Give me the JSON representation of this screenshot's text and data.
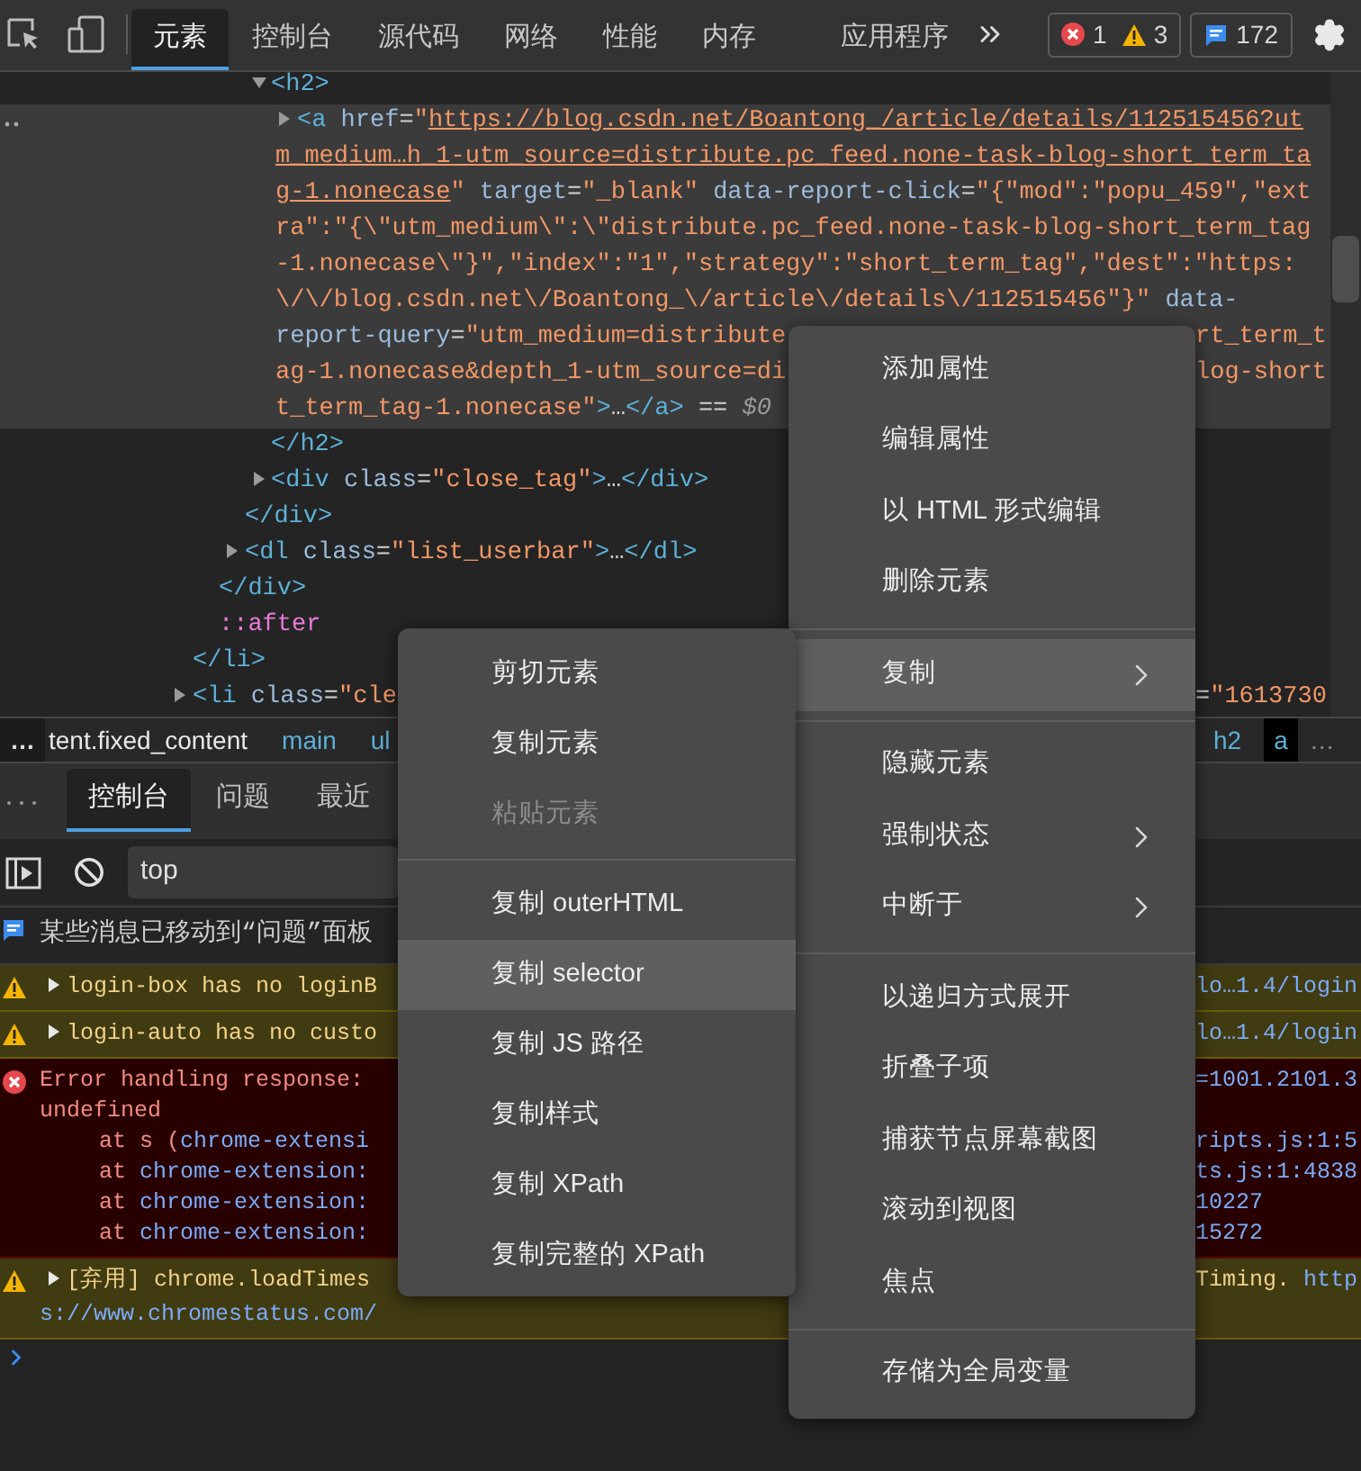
{
  "toolbar": {
    "tabs": [
      {
        "label": "元素",
        "selected": true
      },
      {
        "label": "控制台",
        "selected": false
      },
      {
        "label": "源代码",
        "selected": false
      },
      {
        "label": "网络",
        "selected": false
      },
      {
        "label": "性能",
        "selected": false
      },
      {
        "label": "内存",
        "selected": false
      },
      {
        "label": "应用程序",
        "selected": false
      }
    ],
    "errors": "1",
    "warnings": "3",
    "messages": "172"
  },
  "elements": {
    "tree": [
      {
        "children": [
          {
            "children": [
              {
                "children": [
                  {
                    "expanded": true,
                    "selected": false,
                    "lines": [
                      {
                        "segments": [
                          {
                            "kind": "tag",
                            "text": "<h2>"
                          }
                        ]
                      }
                    ],
                    "children": [
                      {
                        "expanded": false,
                        "selected": true,
                        "lines": [
                          {
                            "segments": [
                              {
                                "kind": "tag",
                                "text": "<a"
                              },
                              {
                                "kind": "attr",
                                "text": " href"
                              },
                              {
                                "kind": "text",
                                "text": "="
                              },
                              {
                                "kind": "value",
                                "text": "\""
                              },
                              {
                                "kind": "link",
                                "text": "https://blog.csdn.net/Boantong_/article/details/112515456?ut"
                              }
                            ]
                          },
                          {
                            "segments": [
                              {
                                "kind": "link",
                                "text": "m_medium…h_1-utm_source=distribute.pc_feed.none-task-blog-short_term_ta"
                              }
                            ]
                          },
                          {
                            "segments": [
                              {
                                "kind": "link",
                                "text": "g-1.nonecase"
                              },
                              {
                                "kind": "value",
                                "text": "\""
                              },
                              {
                                "kind": "attr",
                                "text": " target"
                              },
                              {
                                "kind": "text",
                                "text": "="
                              },
                              {
                                "kind": "value",
                                "text": "\"_blank\""
                              },
                              {
                                "kind": "attr",
                                "text": " data-report-click"
                              },
                              {
                                "kind": "text",
                                "text": "="
                              },
                              {
                                "kind": "value",
                                "text": "\"{\"mod\":\"popu_459\",\"ext"
                              }
                            ]
                          },
                          {
                            "segments": [
                              {
                                "kind": "value",
                                "text": "ra\":\"{\\\"utm_medium\\\":\\\"distribute.pc_feed.none-task-blog-short_term_tag"
                              }
                            ]
                          },
                          {
                            "segments": [
                              {
                                "kind": "value",
                                "text": "-1.nonecase\\\"}\",\"index\":\"1\",\"strategy\":\"short_term_tag\",\"dest\":\"https:"
                              }
                            ]
                          },
                          {
                            "segments": [
                              {
                                "kind": "value",
                                "text": "\\/\\/blog.csdn.net\\/Boantong_\\/article\\/details\\/112515456\"}\""
                              },
                              {
                                "kind": "attr",
                                "text": " data-"
                              }
                            ]
                          },
                          {
                            "segments": [
                              {
                                "kind": "attr",
                                "text": "report-query"
                              },
                              {
                                "kind": "text",
                                "text": "="
                              },
                              {
                                "kind": "value",
                                "text": "\"utm_medium=distribute"
                              }
                            ],
                            "right_segments": [
                              {
                                "kind": "value",
                                "text": "rt_term_t"
                              }
                            ]
                          },
                          {
                            "segments": [
                              {
                                "kind": "value",
                                "text": "ag-1.nonecase&depth_1-utm_source=di"
                              }
                            ],
                            "right_segments": [
                              {
                                "kind": "value",
                                "text": "log-short"
                              }
                            ]
                          },
                          {
                            "segments": [
                              {
                                "kind": "value",
                                "text": "t_term_tag-1.nonecase\""
                              },
                              {
                                "kind": "tag",
                                "text": ">"
                              },
                              {
                                "kind": "text",
                                "text": "…"
                              },
                              {
                                "kind": "tag",
                                "text": "</a>"
                              },
                              {
                                "kind": "text",
                                "text": " == "
                              },
                              {
                                "kind": "comment",
                                "text": "$0"
                              }
                            ]
                          }
                        ]
                      }
                    ]
                  },
                  {
                    "selected": false,
                    "lines": [
                      {
                        "segments": [
                          {
                            "kind": "tag",
                            "text": "</h2>"
                          }
                        ]
                      }
                    ]
                  },
                  {
                    "expanded": false,
                    "selected": false,
                    "lines": [
                      {
                        "segments": [
                          {
                            "kind": "tag",
                            "text": "<div"
                          },
                          {
                            "kind": "attr",
                            "text": " class"
                          },
                          {
                            "kind": "text",
                            "text": "="
                          },
                          {
                            "kind": "value",
                            "text": "\"close_tag\""
                          },
                          {
                            "kind": "tag",
                            "text": ">"
                          },
                          {
                            "kind": "text",
                            "text": "…"
                          },
                          {
                            "kind": "tag",
                            "text": "</div>"
                          }
                        ]
                      }
                    ]
                  }
                ]
              },
              {
                "selected": false,
                "lines": [
                  {
                    "segments": [
                      {
                        "kind": "tag",
                        "text": "</div>"
                      }
                    ]
                  }
                ]
              },
              {
                "expanded": false,
                "selected": false,
                "lines": [
                  {
                    "segments": [
                      {
                        "kind": "tag",
                        "text": "<dl"
                      },
                      {
                        "kind": "attr",
                        "text": " class"
                      },
                      {
                        "kind": "text",
                        "text": "="
                      },
                      {
                        "kind": "value",
                        "text": "\"list_userbar\""
                      },
                      {
                        "kind": "tag",
                        "text": ">"
                      },
                      {
                        "kind": "text",
                        "text": "…"
                      },
                      {
                        "kind": "tag",
                        "text": "</dl>"
                      }
                    ]
                  }
                ]
              }
            ]
          },
          {
            "selected": false,
            "lines": [
              {
                "segments": [
                  {
                    "kind": "tag",
                    "text": "</div>"
                  }
                ]
              }
            ]
          },
          {
            "selected": false,
            "lines": [
              {
                "segments": [
                  {
                    "kind": "pseudo",
                    "text": "::after"
                  }
                ]
              }
            ]
          }
        ]
      },
      {
        "selected": false,
        "lines": [
          {
            "segments": [
              {
                "kind": "tag",
                "text": "</li>"
              }
            ]
          }
        ]
      },
      {
        "expanded": false,
        "selected": false,
        "lines": [
          {
            "segments": [
              {
                "kind": "tag",
                "text": "<li"
              },
              {
                "kind": "attr",
                "text": " class"
              },
              {
                "kind": "text",
                "text": "="
              },
              {
                "kind": "value",
                "text": "\"cle"
              }
            ],
            "right_segments": [
              {
                "kind": "text",
                "text": "="
              },
              {
                "kind": "value",
                "text": "\"1613730"
              }
            ]
          }
        ]
      }
    ]
  },
  "breadcrumbs": {
    "left_more": "…",
    "left": [
      {
        "label": "tent.fixed_content",
        "kind": "class",
        "selected": false
      },
      {
        "label": "main",
        "kind": "tag",
        "selected": false
      },
      {
        "label": "ul",
        "kind": "tag",
        "selected": false
      }
    ],
    "right": [
      {
        "label": "h2",
        "kind": "tag",
        "selected": false
      },
      {
        "label": "a",
        "kind": "tag",
        "selected": true
      }
    ],
    "right_more": "…"
  },
  "drawer": {
    "tabs": [
      {
        "label": "控制台",
        "selected": true
      },
      {
        "label": "问题",
        "selected": false
      },
      {
        "label": "最近",
        "selected": false
      }
    ]
  },
  "console": {
    "context": "top",
    "messages": [
      {
        "kind": "info",
        "lines": [
          {
            "segments": [
              {
                "kind": "text",
                "text": "某些消息已移动到“问题”面板"
              }
            ]
          }
        ]
      },
      {
        "kind": "warning",
        "expanded": false,
        "lines": [
          {
            "segments": [
              {
                "kind": "text",
                "text": "login-box has no loginB"
              }
            ],
            "right_segments": [
              {
                "kind": "link",
                "text": "lo…1.4/login"
              }
            ]
          }
        ]
      },
      {
        "kind": "warning",
        "expanded": false,
        "lines": [
          {
            "segments": [
              {
                "kind": "text",
                "text": "login-auto has no custo"
              }
            ],
            "right_segments": [
              {
                "kind": "link",
                "text": "lo…1.4/login"
              }
            ]
          }
        ]
      },
      {
        "kind": "error",
        "lines": [
          {
            "kind": "message",
            "segments": [
              {
                "kind": "text",
                "text": "Error handling response:"
              }
            ],
            "right_segments": [
              {
                "kind": "link",
                "text": "=1001.2101.3"
              }
            ]
          },
          {
            "kind": "message",
            "segments": [
              {
                "kind": "text",
                "text": "undefined"
              }
            ]
          },
          {
            "kind": "stack",
            "segments": [
              {
                "kind": "text",
                "text": "at s ("
              },
              {
                "kind": "link",
                "text": "chrome-extensi"
              }
            ],
            "right_segments": [
              {
                "kind": "link",
                "text": "ripts.js:1:5"
              }
            ]
          },
          {
            "kind": "stack",
            "segments": [
              {
                "kind": "text",
                "text": "at "
              },
              {
                "kind": "link",
                "text": "chrome-extension:"
              }
            ],
            "right_segments": [
              {
                "kind": "link",
                "text": "ts.js:1:4838"
              }
            ]
          },
          {
            "kind": "stack",
            "segments": [
              {
                "kind": "text",
                "text": "at "
              },
              {
                "kind": "link",
                "text": "chrome-extension:"
              }
            ],
            "right_segments": [
              {
                "kind": "link",
                "text": "10227"
              }
            ]
          },
          {
            "kind": "stack",
            "segments": [
              {
                "kind": "text",
                "text": "at "
              },
              {
                "kind": "link",
                "text": "chrome-extension:"
              }
            ],
            "right_segments": [
              {
                "kind": "link",
                "text": "15272"
              }
            ]
          }
        ]
      },
      {
        "kind": "warning",
        "expanded": false,
        "lines": [
          {
            "segments": [
              {
                "kind": "text",
                "text": "[弃用] chrome.loadTimes"
              }
            ],
            "right_segments": [
              {
                "kind": "text",
                "text": "Timing. "
              },
              {
                "kind": "link",
                "text": "http"
              }
            ]
          },
          {
            "segments": [
              {
                "kind": "link",
                "text": "s://www.chromestatus.com/"
              }
            ]
          }
        ]
      },
      {
        "kind": "prompt"
      }
    ]
  },
  "context_menu": {
    "items": [
      {
        "kind": "item",
        "label": "添加属性",
        "selected": false,
        "submenu": false
      },
      {
        "kind": "item",
        "label": "编辑属性",
        "selected": false,
        "submenu": false
      },
      {
        "kind": "item",
        "label": "以 HTML 形式编辑",
        "selected": false,
        "submenu": false
      },
      {
        "kind": "item",
        "label": "删除元素",
        "selected": false,
        "submenu": false
      },
      {
        "kind": "separator"
      },
      {
        "kind": "item",
        "label": "复制",
        "selected": true,
        "submenu": true
      },
      {
        "kind": "separator"
      },
      {
        "kind": "item",
        "label": "隐藏元素",
        "selected": false,
        "submenu": false
      },
      {
        "kind": "item",
        "label": "强制状态",
        "selected": false,
        "submenu": true
      },
      {
        "kind": "item",
        "label": "中断于",
        "selected": false,
        "submenu": true
      },
      {
        "kind": "separator"
      },
      {
        "kind": "item",
        "label": "以递归方式展开",
        "selected": false,
        "submenu": false
      },
      {
        "kind": "item",
        "label": "折叠子项",
        "selected": false,
        "submenu": false
      },
      {
        "kind": "item",
        "label": "捕获节点屏幕截图",
        "selected": false,
        "submenu": false
      },
      {
        "kind": "item",
        "label": "滚动到视图",
        "selected": false,
        "submenu": false
      },
      {
        "kind": "item",
        "label": "焦点",
        "selected": false,
        "submenu": false
      },
      {
        "kind": "separator"
      },
      {
        "kind": "item",
        "label": "存储为全局变量",
        "selected": false,
        "submenu": false
      }
    ]
  },
  "copy_submenu": {
    "items": [
      {
        "kind": "item",
        "label": "剪切元素",
        "selected": false,
        "disabled": false
      },
      {
        "kind": "item",
        "label": "复制元素",
        "selected": false,
        "disabled": false
      },
      {
        "kind": "item",
        "label": "粘贴元素",
        "selected": false,
        "disabled": true
      },
      {
        "kind": "separator"
      },
      {
        "kind": "item",
        "label": "复制 outerHTML",
        "selected": false,
        "disabled": false
      },
      {
        "kind": "item",
        "label": "复制 selector",
        "selected": true,
        "disabled": false
      },
      {
        "kind": "item",
        "label": "复制 JS 路径",
        "selected": false,
        "disabled": false
      },
      {
        "kind": "item",
        "label": "复制样式",
        "selected": false,
        "disabled": false
      },
      {
        "kind": "item",
        "label": "复制 XPath",
        "selected": false,
        "disabled": false
      },
      {
        "kind": "item",
        "label": "复制完整的 XPath",
        "selected": false,
        "disabled": false
      }
    ]
  }
}
